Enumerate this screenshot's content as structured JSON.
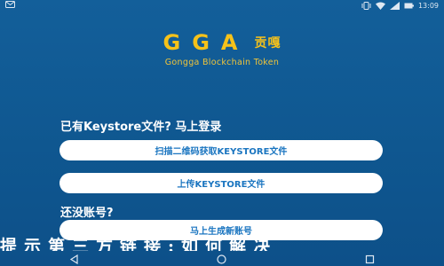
{
  "status_bar": {
    "time": "13:09",
    "battery": "100",
    "icons": [
      "notification-icon",
      "vibrate-icon",
      "wifi-icon",
      "signal-icon",
      "battery-icon"
    ]
  },
  "logo": {
    "main": "GGA",
    "cn": "贡嘎",
    "subtitle": "Gongga Blockchain Token"
  },
  "keystore": {
    "prompt": "已有Keystore文件? 马上登录",
    "scan_button": "扫描二维码获取KEYSTORE文件",
    "upload_button": "上传KEYSTORE文件"
  },
  "register": {
    "prompt": "还没账号?",
    "create_button": "马上生成新账号"
  },
  "banner": {
    "text": "提示第三方链接:如何解决"
  },
  "nav": {
    "icons": [
      "back-icon",
      "home-icon",
      "recent-apps-icon"
    ]
  },
  "colors": {
    "background": "#135f9a",
    "accent": "#f6c21a",
    "button_text": "#1a75c0"
  }
}
